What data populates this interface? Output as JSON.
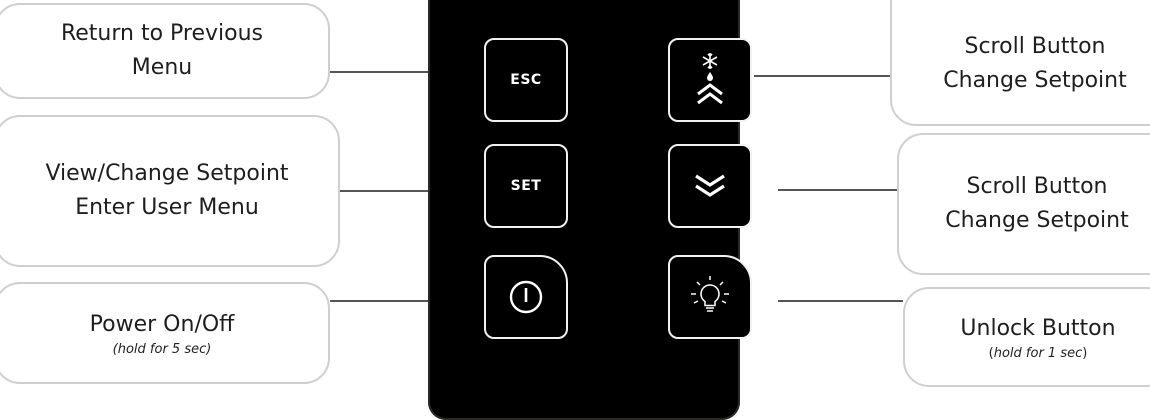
{
  "callouts": {
    "esc": {
      "lines": [
        "Return to Previous",
        "Menu"
      ]
    },
    "set": {
      "lines": [
        "View/Change Setpoint",
        "Enter User Menu"
      ]
    },
    "power": {
      "title": "Power On/Off",
      "note": "(hold for 5 sec)"
    },
    "up": {
      "lines": [
        "Scroll Button",
        "Change Setpoint"
      ]
    },
    "down": {
      "lines": [
        "Scroll Button",
        "Change Setpoint"
      ]
    },
    "light": {
      "title": "Unlock Button",
      "note_prefix": "(",
      "note_italic": "hold for 1 sec",
      "note_suffix": ")"
    }
  },
  "keys": {
    "esc_label": "ESC",
    "set_label": "SET"
  },
  "icons": {
    "up": "snowflake-drop-double-chevron-up-icon",
    "down": "double-chevron-down-icon",
    "power": "power-icon",
    "light": "light-bulb-icon"
  },
  "colors": {
    "panel": "#000000",
    "key_border": "#f2f2f2",
    "callout_border": "#cfcfcf"
  }
}
